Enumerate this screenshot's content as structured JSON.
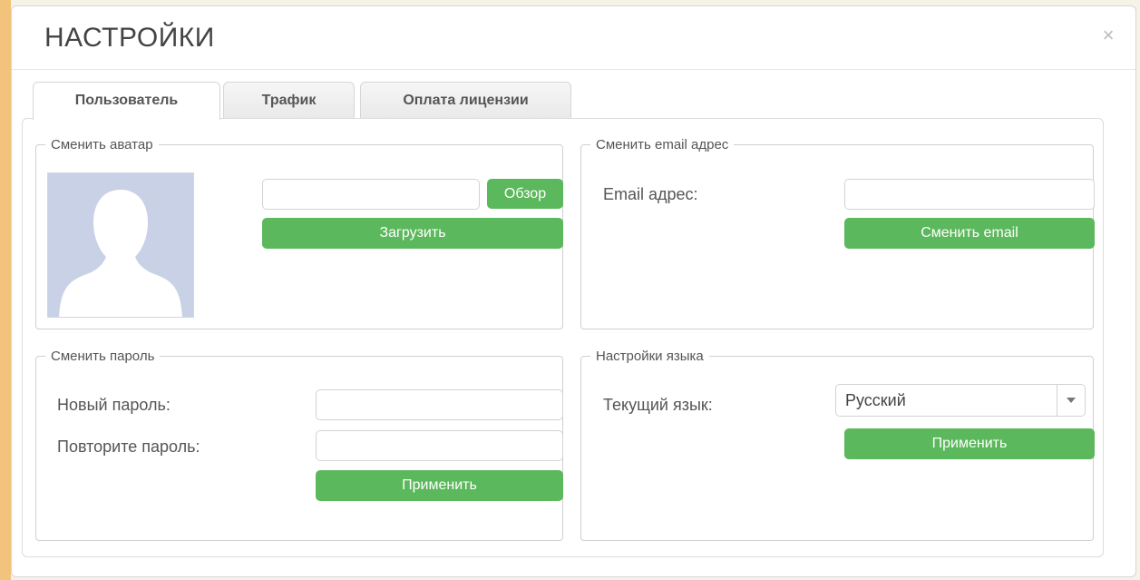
{
  "modal": {
    "title": "НАСТРОЙКИ",
    "close_icon": "close-icon",
    "close_glyph": "×"
  },
  "tabs": [
    {
      "label": "Пользователь",
      "active": true
    },
    {
      "label": "Трафик",
      "active": false
    },
    {
      "label": "Оплата лицензии",
      "active": false
    }
  ],
  "sections": {
    "avatar": {
      "legend": "Сменить аватар",
      "file_input_value": "",
      "browse_label": "Обзор",
      "upload_label": "Загрузить",
      "avatar_icon": "person-silhouette-icon"
    },
    "email": {
      "legend": "Сменить email адрес",
      "field_label": "Email адрес:",
      "input_value": "",
      "button_label": "Сменить email"
    },
    "password": {
      "legend": "Сменить пароль",
      "new_label": "Новый пароль:",
      "repeat_label": "Повторите пароль:",
      "new_value": "",
      "repeat_value": "",
      "apply_label": "Применить"
    },
    "language": {
      "legend": "Настройки языка",
      "current_label": "Текущий язык:",
      "selected": "Русский",
      "apply_label": "Применить"
    }
  },
  "colors": {
    "accent": "#5cb85c",
    "avatar_bg": "#c9d1e6",
    "avatar_silhouette": "#ffffff"
  }
}
